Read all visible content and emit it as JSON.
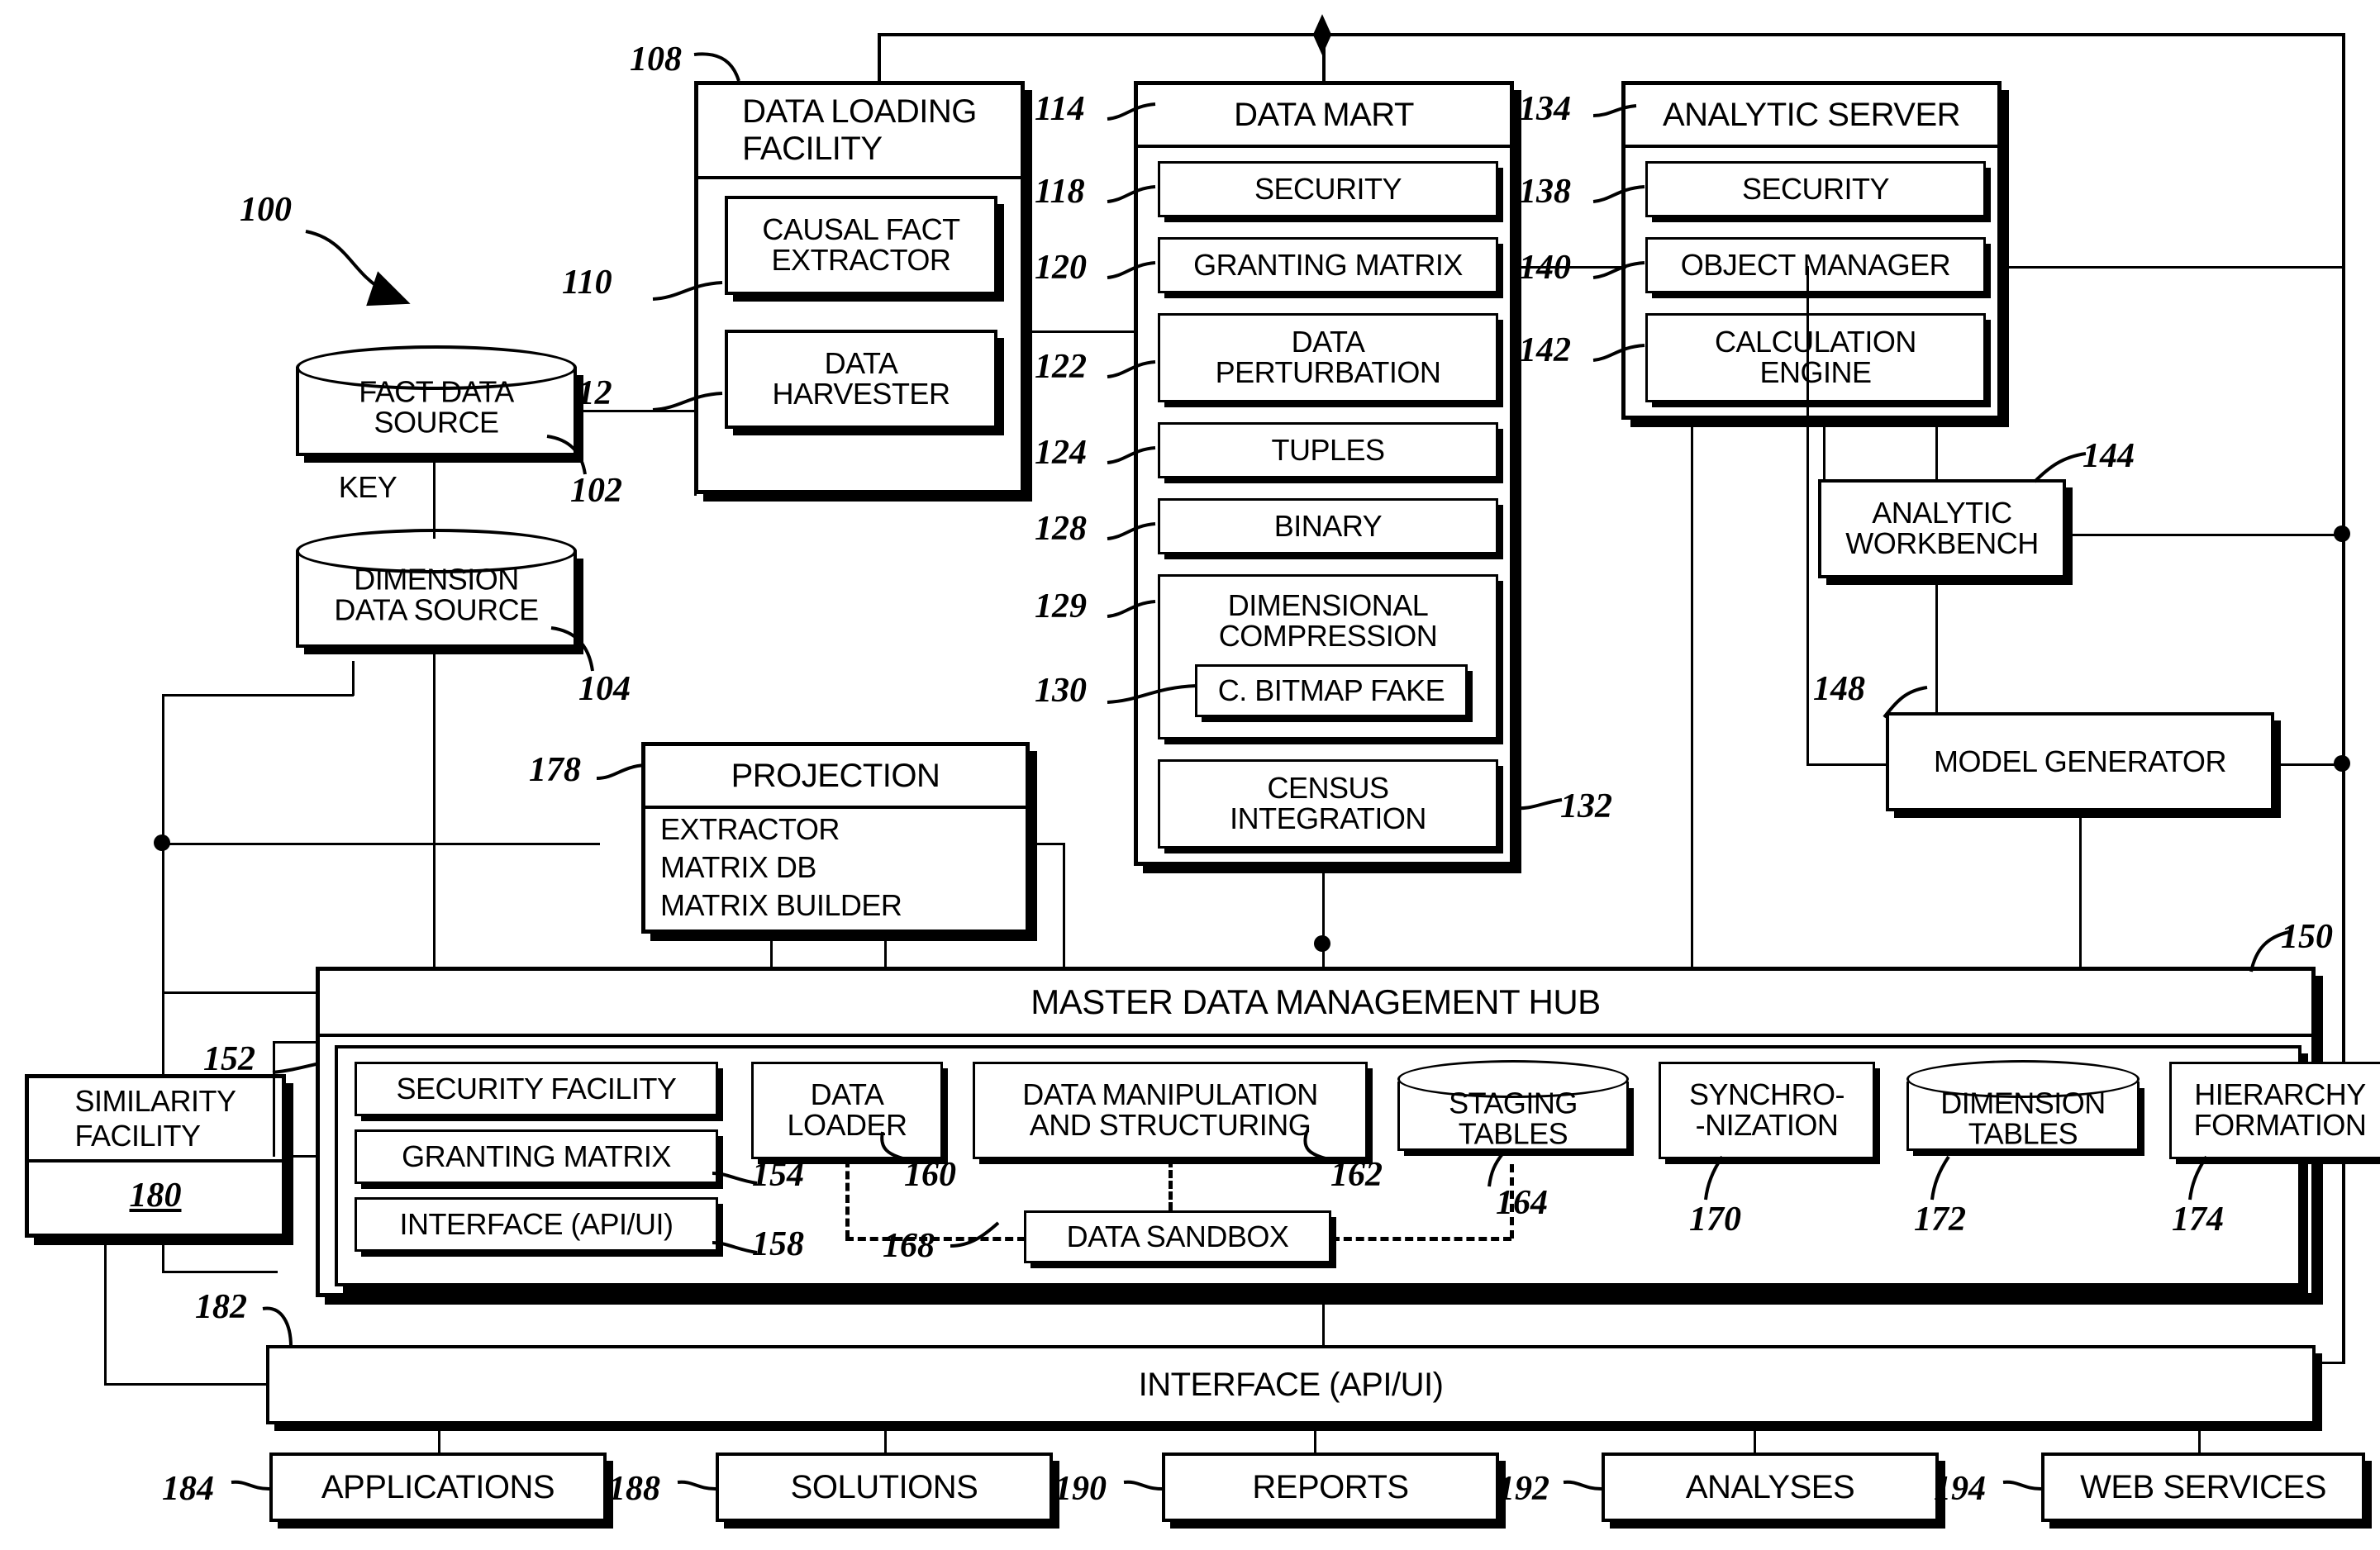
{
  "figure": {
    "root_ref": "100"
  },
  "data_loading_facility": {
    "ref": "108",
    "title": "DATA LOADING FACILITY",
    "items": [
      {
        "ref": "110",
        "label": "CAUSAL FACT EXTRACTOR"
      },
      {
        "ref": "112",
        "label": "DATA HARVESTER"
      }
    ]
  },
  "sources": {
    "fact": {
      "ref": "102",
      "label": "FACT DATA SOURCE"
    },
    "dimension": {
      "ref": "104",
      "label": "DIMENSION DATA SOURCE"
    },
    "key_label": "KEY"
  },
  "data_mart": {
    "ref": "114",
    "title": "DATA MART",
    "items": [
      {
        "ref": "118",
        "label": "SECURITY"
      },
      {
        "ref": "120",
        "label": "GRANTING MATRIX"
      },
      {
        "ref": "122",
        "label": "DATA PERTURBATION"
      },
      {
        "ref": "124",
        "label": "TUPLES"
      },
      {
        "ref": "128",
        "label": "BINARY"
      },
      {
        "ref": "129",
        "label": "DIMENSIONAL COMPRESSION"
      },
      {
        "ref": "130",
        "label": "C. BITMAP FAKE"
      },
      {
        "ref": "132",
        "label": "CENSUS INTEGRATION"
      }
    ]
  },
  "analytic_server": {
    "ref": "134",
    "title": "ANALYTIC SERVER",
    "items": [
      {
        "ref": "138",
        "label": "SECURITY"
      },
      {
        "ref": "140",
        "label": "OBJECT MANAGER"
      },
      {
        "ref": "142",
        "label": "CALCULATION ENGINE"
      }
    ]
  },
  "analytic_workbench": {
    "ref": "144",
    "label": "ANALYTIC WORKBENCH"
  },
  "model_generator": {
    "ref": "148",
    "label": "MODEL GENERATOR"
  },
  "projection": {
    "ref": "178",
    "title": "PROJECTION",
    "lines": [
      "EXTRACTOR",
      "MATRIX DB",
      "MATRIX BUILDER"
    ]
  },
  "similarity_facility": {
    "ref_top": "152",
    "label": "SIMILARITY FACILITY",
    "ref_inner": "180"
  },
  "mdm_hub": {
    "ref": "150",
    "title": "MASTER DATA MANAGEMENT HUB",
    "left_stack": [
      {
        "ref": "154",
        "label": "SECURITY FACILITY"
      },
      {
        "ref": "",
        "label": "GRANTING MATRIX"
      },
      {
        "ref": "158",
        "label": "INTERFACE (API/UI)"
      }
    ],
    "modules": [
      {
        "ref": "160",
        "label": "DATA LOADER",
        "shape": "box"
      },
      {
        "ref": "162",
        "label": "DATA MANIPULATION AND STRUCTURING",
        "shape": "box"
      },
      {
        "ref": "164",
        "label": "STAGING TABLES",
        "shape": "cylinder"
      },
      {
        "ref": "170",
        "label": "SYNCHRO- -NIZATION",
        "shape": "box"
      },
      {
        "ref": "172",
        "label": "DIMENSION TABLES",
        "shape": "cylinder"
      },
      {
        "ref": "174",
        "label": "HIERARCHY FORMATION",
        "shape": "box"
      }
    ],
    "sandbox": {
      "ref": "168",
      "label": "DATA SANDBOX"
    }
  },
  "interface_bar": {
    "ref": "182",
    "label": "INTERFACE (API/UI)"
  },
  "outputs": [
    {
      "ref": "184",
      "label": "APPLICATIONS"
    },
    {
      "ref": "188",
      "label": "SOLUTIONS"
    },
    {
      "ref": "190",
      "label": "REPORTS"
    },
    {
      "ref": "192",
      "label": "ANALYSES"
    },
    {
      "ref": "194",
      "label": "WEB SERVICES"
    }
  ]
}
